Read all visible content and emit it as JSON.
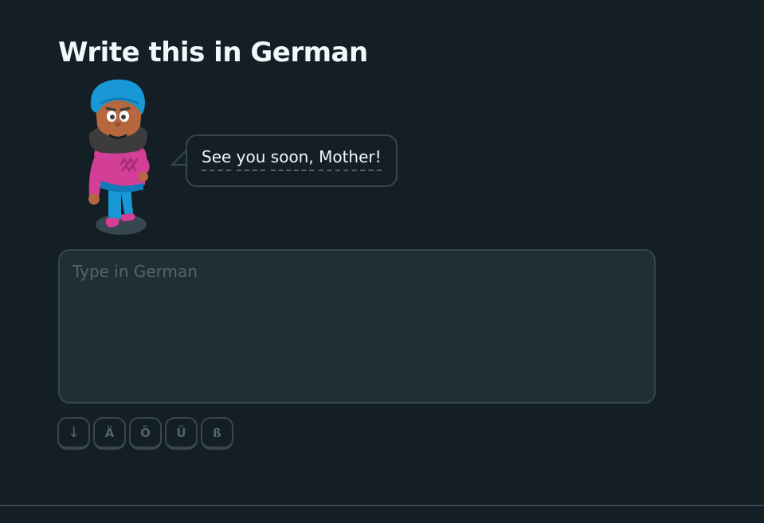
{
  "prompt": {
    "title": "Write this in German"
  },
  "speech_bubble": {
    "words": [
      "See",
      "you",
      "soon,",
      "Mother!"
    ]
  },
  "answer": {
    "value": "",
    "placeholder": "Type in German"
  },
  "special_keys": {
    "arrow": "↓",
    "a_umlaut": "Ä",
    "o_umlaut": "Ö",
    "u_umlaut": "Ü",
    "eszett": "ß"
  },
  "colors": {
    "background": "#131f24",
    "text": "#f1f7fb",
    "border": "#37464f",
    "muted": "#52656d",
    "input_background": "#202f36"
  }
}
